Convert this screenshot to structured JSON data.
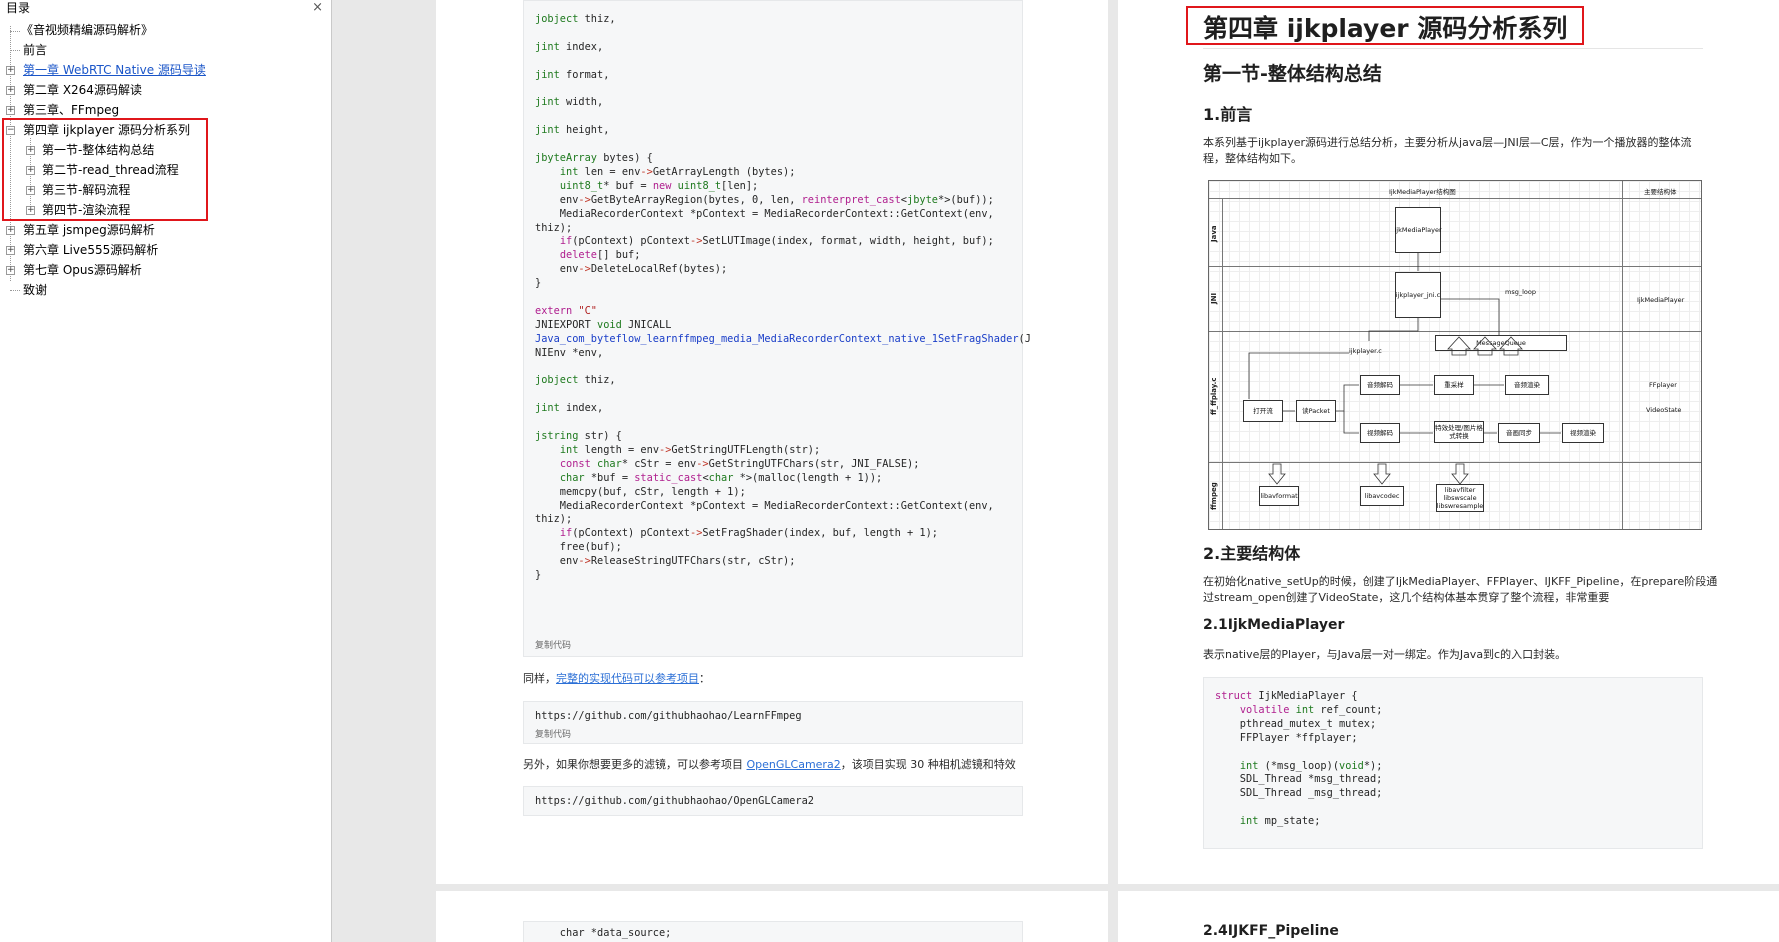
{
  "sidebar": {
    "title": "目录",
    "close": "×",
    "items": [
      {
        "label": "《音视频精编源码解析》"
      },
      {
        "label": "前言"
      },
      {
        "label": "第一章 WebRTC Native 源码导读"
      },
      {
        "label": "第二章 X264源码解读"
      },
      {
        "label": "第三章、FFmpeg"
      },
      {
        "label": "第四章 ijkplayer 源码分析系列"
      },
      {
        "label": "第一节-整体结构总结"
      },
      {
        "label": "第二节-read_thread流程"
      },
      {
        "label": "第三节-解码流程"
      },
      {
        "label": "第四节-渲染流程"
      },
      {
        "label": "第五章 jsmpeg源码解析"
      },
      {
        "label": "第六章 Live555源码解析"
      },
      {
        "label": "第七章 Opus源码解析"
      },
      {
        "label": "致谢"
      }
    ]
  },
  "left_page": {
    "code1_lines": [
      "jobject thiz,",
      "",
      "jint index,",
      "",
      "jint format,",
      "",
      "jint width,",
      "",
      "jint height,",
      "",
      "jbyteArray bytes) {",
      "    int len = env->GetArrayLength (bytes);",
      "    uint8_t* buf = new uint8_t[len];",
      "    env->GetByteArrayRegion(bytes, 0, len, reinterpret_cast<jbyte*>(buf));",
      "    MediaRecorderContext *pContext = MediaRecorderContext::GetContext(env,",
      "thiz);",
      "    if(pContext) pContext->SetLUTImage(index, format, width, height, buf);",
      "    delete[] buf;",
      "    env->DeleteLocalRef(bytes);",
      "}",
      "",
      "extern \"C\"",
      "JNIEXPORT void JNICALL",
      "Java_com_byteflow_learnffmpeg_media_MediaRecorderContext_native_1SetFragShader(J",
      "NIEnv *env,",
      "",
      "jobject thiz,",
      "",
      "jint index,",
      "",
      "jstring str) {",
      "    int length = env->GetStringUTFLength(str);",
      "    const char* cStr = env->GetStringUTFChars(str, JNI_FALSE);",
      "    char *buf = static_cast<char *>(malloc(length + 1));",
      "    memcpy(buf, cStr, length + 1);",
      "    MediaRecorderContext *pContext = MediaRecorderContext::GetContext(env,",
      "thiz);",
      "    if(pContext) pContext->SetFragShader(index, buf, length + 1);",
      "    free(buf);",
      "    env->ReleaseStringUTFChars(str, cStr);",
      "}"
    ],
    "copy_label": "复制代码",
    "para1_prefix": "同样，",
    "para1_link": "完整的实现代码可以参考项目",
    "para1_suffix": "：",
    "url1": "https://github.com/githubhaohao/LearnFFmpeg",
    "copy_label2": "复制代码",
    "para2_prefix": "另外，如果你想要更多的滤镜，可以参考项目 ",
    "para2_link": "OpenGLCamera2",
    "para2_suffix": "，该项目实现 30 种相机滤镜和特效",
    "url2": "https://github.com/githubhaohao/OpenGLCamera2",
    "bottom_code": "    char *data_source;"
  },
  "right_page": {
    "chapter_title": "第四章 ijkplayer 源码分析系列",
    "section_title": "第一节-整体结构总结",
    "h_preface": "1.前言",
    "preface_line1": "本系列基于ijkplayer源码进行总结分析，主要分析从java层—JNI层—C层，作为一个播放器的整体流",
    "preface_line2": "程，整体结构如下。",
    "h_main_struct": "2.主要结构体",
    "main_line1": "在初始化native_setUp的时候，创建了IjkMediaPlayer、FFPlayer、IJKFF_Pipeline，在prepare阶段通",
    "main_line2": "过stream_open创建了VideoState，这几个结构体基本贯穿了整个流程，非常重要",
    "h_ijk": "2.1IjkMediaPlayer",
    "ijk_desc": "表示native层的Player，与Java层一对一绑定。作为Java到c的入口封装。",
    "struct_lines": [
      "struct IjkMediaPlayer {",
      "    volatile int ref_count;",
      "    pthread_mutex_t mutex;",
      "    FFPlayer *ffplayer;",
      "",
      "    int (*msg_loop)(void*);",
      "    SDL_Thread *msg_thread;",
      "    SDL_Thread _msg_thread;",
      "",
      "    int mp_state;"
    ],
    "bottom_heading": "2.4IJKFF_Pipeline"
  },
  "diagram": {
    "header_main": "IjkMediaPlayer结构图",
    "header_side": "主要结构体",
    "lanes": [
      "Java",
      "JNI",
      "ff_ffplay.c",
      "ffmpeg"
    ],
    "side_labels": [
      "IjkMediaPlayer",
      "FFplayer",
      "VideoState"
    ],
    "boxes": {
      "java_box": "IjkMediaPlayer",
      "jni_box": "ijkplayer_jni.c",
      "msg_loop": "msg_loop",
      "ijkplayer_c": "ijkplayer.c",
      "message_queue": "MessageQueue",
      "open_stream": "打开流",
      "read_packet": "读Packet",
      "audio_decode": "音频解码",
      "resample": "重采样",
      "audio_render": "音频渲染",
      "video_decode": "视频解码",
      "pixfmt": "特效处理/图片格式转换",
      "av_sync": "音画同步",
      "video_render": "视频渲染",
      "libavformat": "libavformat",
      "libavcodec": "libavcodec",
      "libavfilter": "libavfilter",
      "libswscale": "libswscale",
      "libswresample": "libswresample"
    }
  }
}
